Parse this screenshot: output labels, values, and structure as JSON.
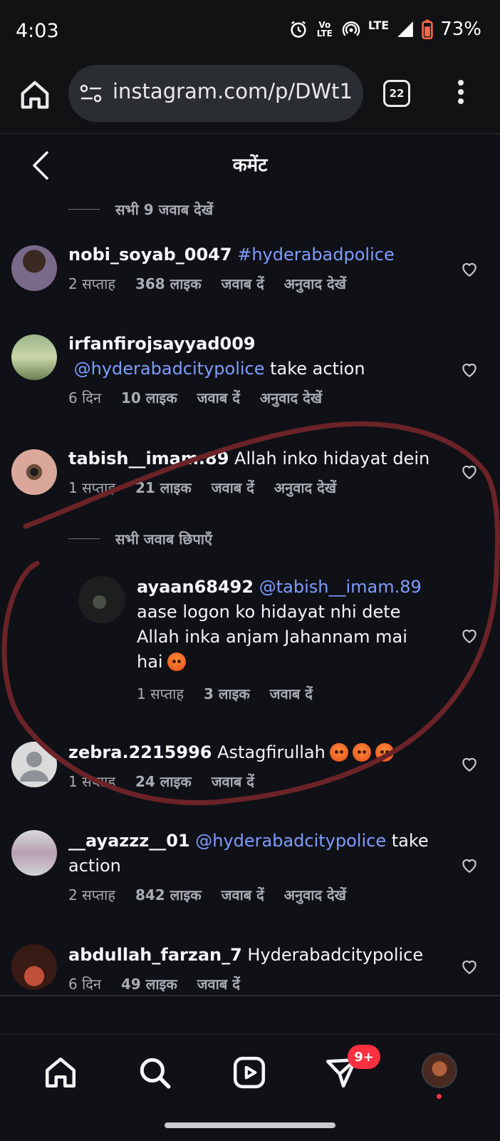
{
  "status_bar": {
    "time": "4:03",
    "volte": "Vo LTE",
    "lte": "LTE",
    "battery": "73%"
  },
  "browser": {
    "url": "instagram.com/p/DWt1",
    "tab_count": "22"
  },
  "header": {
    "title": "कमेंट"
  },
  "replies_view_all": "सभी 9 जवाब देखें",
  "replies_hide_all": "सभी जवाब छिपाएँ",
  "comments": [
    {
      "username": "nobi_soyab_0047",
      "text": "",
      "mention": "#hyderabadpolice",
      "time": "2 सप्ताह",
      "likes": "368 लाइक",
      "reply": "जवाब दें",
      "translate": "अनुवाद देखें"
    },
    {
      "username": "irfanfirojsayyad009",
      "mention": "@hyderabadcitypolice",
      "text": " take action",
      "time": "6 दिन",
      "likes": "10 लाइक",
      "reply": "जवाब दें",
      "translate": "अनुवाद देखें"
    },
    {
      "username": "tabish__imam.89",
      "text": " Allah inko hidayat dein",
      "time": "1 सप्ताह",
      "likes": "21 लाइक",
      "reply": "जवाब दें",
      "translate": "अनुवाद देखें"
    },
    {
      "username": "ayaan68492",
      "mention": "@tabish__imam.89",
      "text": "aase logon ko hidayat nhi dete Allah inka anjam Jahannam mai hai",
      "time": "1 सप्ताह",
      "likes": "3 लाइक",
      "reply": "जवाब दें"
    },
    {
      "username": "zebra.2215996",
      "text": " Astagfirullah",
      "time": "1 सप्ताह",
      "likes": "24 लाइक",
      "reply": "जवाब दें"
    },
    {
      "username": "__ayazzz__01",
      "mention": "@hyderabadcitypolice",
      "text": " take action",
      "time": "2 सप्ताह",
      "likes": "842 लाइक",
      "reply": "जवाब दें",
      "translate": "अनुवाद देखें"
    },
    {
      "username": "abdullah_farzan_7",
      "text": " Hyderabadcitypolice",
      "time": "6 दिन",
      "likes": "49 लाइक",
      "reply": "जवाब दें"
    }
  ],
  "nav": {
    "messages_badge": "9+"
  },
  "colors": {
    "background": "#0f1116",
    "mention": "#7f9cff",
    "annotation": "#6b2328",
    "badge": "#ff3040"
  },
  "icons": [
    "home-icon",
    "tune-icon",
    "tabs-icon",
    "more-vert-icon",
    "back-chevron-icon",
    "heart-icon",
    "search-icon",
    "reels-icon",
    "send-icon",
    "alarm-icon",
    "hotspot-icon",
    "signal-icon",
    "battery-icon"
  ]
}
